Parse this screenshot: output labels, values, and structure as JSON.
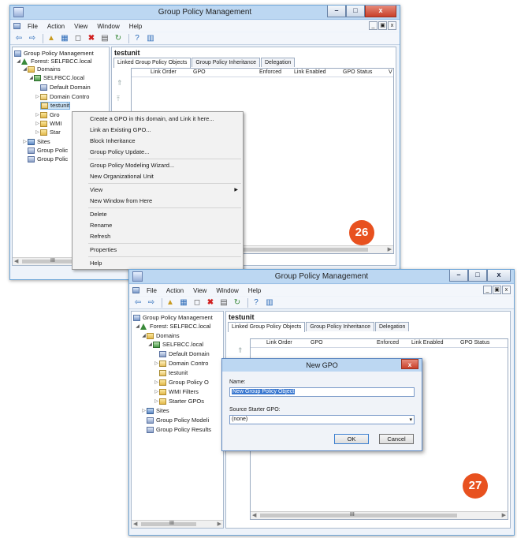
{
  "window1": {
    "title": "Group Policy Management",
    "menu": [
      "File",
      "Action",
      "View",
      "Window",
      "Help"
    ],
    "caption_buttons": {
      "minimize": "–",
      "maximize": "□",
      "close": "x"
    },
    "mdi_buttons": {
      "minimize": "_",
      "restore": "▣",
      "close": "x"
    },
    "tree": {
      "root": "Group Policy Management",
      "forest": "Forest: SELFBCC.local",
      "domains": "Domains",
      "domain": "SELFBCC.local",
      "default_domain": "Default Domain",
      "domain_controllers": "Domain Contro",
      "ou": "testunit",
      "gpo_objects": "Gro",
      "wmi": "WMI",
      "starter": "Star",
      "sites": "Sites",
      "gp_modeling": "Group Polic",
      "gp_results": "Group Polic"
    },
    "pane_title": "testunit",
    "tabs": [
      "Linked Group Policy Objects",
      "Group Policy Inheritance",
      "Delegation"
    ],
    "columns": [
      "Link Order",
      "GPO",
      "Enforced",
      "Link Enabled",
      "GPO Status",
      "V"
    ],
    "scroll_label": "III",
    "context_menu": {
      "items": [
        "Create a GPO in this domain, and Link it here...",
        "Link an Existing GPO...",
        "Block Inheritance",
        "Group Policy Update...",
        "Group Policy Modeling Wizard...",
        "New Organizational Unit",
        "View",
        "New Window from Here",
        "Delete",
        "Rename",
        "Refresh",
        "Properties",
        "Help"
      ]
    },
    "badge": "26"
  },
  "window2": {
    "title": "Group Policy Management",
    "menu": [
      "File",
      "Action",
      "View",
      "Window",
      "Help"
    ],
    "caption_buttons": {
      "minimize": "–",
      "maximize": "□",
      "close": "x"
    },
    "mdi_buttons": {
      "minimize": "_",
      "restore": "▣",
      "close": "x"
    },
    "tree": {
      "root": "Group Policy Management",
      "forest": "Forest: SELFBCC.local",
      "domains": "Domains",
      "domain": "SELFBCC.local",
      "default_domain": "Default Domain",
      "domain_controllers": "Domain Contro",
      "ou": "testunit",
      "gpo_objects": "Group Policy O",
      "wmi": "WMI Filters",
      "starter": "Starter GPOs",
      "sites": "Sites",
      "gp_modeling": "Group Policy Modeli",
      "gp_results": "Group Policy Results"
    },
    "pane_title": "testunit",
    "tabs": [
      "Linked Group Policy Objects",
      "Group Policy Inheritance",
      "Delegation"
    ],
    "columns": [
      "Link Order",
      "GPO",
      "Enforced",
      "Link Enabled",
      "GPO Status"
    ],
    "scroll_label": "III",
    "badge": "27"
  },
  "dialog": {
    "title": "New GPO",
    "close": "x",
    "name_label": "Name:",
    "name_value": "New Group Policy Object",
    "starter_label": "Source Starter GPO:",
    "starter_value": "(none)",
    "ok": "OK",
    "cancel": "Cancel"
  }
}
